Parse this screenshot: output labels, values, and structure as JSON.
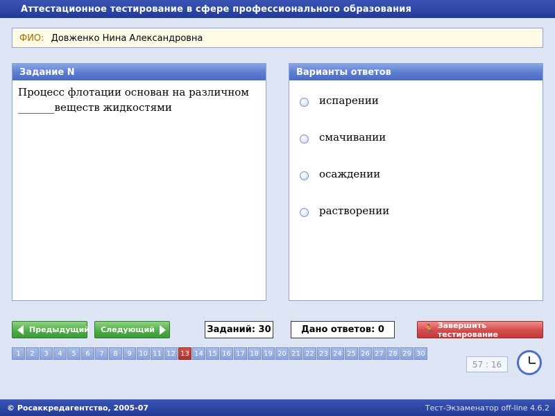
{
  "title": "Аттестационное тестирование в сфере профессионального образования",
  "fio": {
    "label": "ФИО:",
    "value": "Довженко Нина Александровна"
  },
  "question_panel": {
    "header": "Задание N",
    "line1": "Процесс флотации основан на различном",
    "line2": "_______веществ жидкостями"
  },
  "answers_panel": {
    "header": "Варианты ответов",
    "options": [
      "испарении",
      "смачивании",
      "осаждении",
      "растворении"
    ]
  },
  "nav": {
    "prev_label": "Предыдущий",
    "next_label": "Следующий",
    "tasks_counter": "Заданий: 30",
    "answers_counter": "Дано ответов: 0",
    "finish_label": "Завершить тестирование"
  },
  "pages": {
    "items": [
      "1",
      "2",
      "3",
      "4",
      "5",
      "6",
      "7",
      "8",
      "9",
      "10",
      "11",
      "12",
      "13",
      "14",
      "15",
      "16",
      "17",
      "18",
      "19",
      "20",
      "21",
      "22",
      "23",
      "24",
      "25",
      "26",
      "27",
      "28",
      "29",
      "30"
    ],
    "current": "13"
  },
  "timer": "57 : 16",
  "footer": {
    "left": "© Росаккредагентство, 2005-07",
    "right": "Тест-Экзаменатор off-line 4.6.2"
  },
  "colors": {
    "titlebar": "#2c45a3",
    "panel_header": "#5b7cd0",
    "background": "#dde4f3",
    "nav_button": "#4fae48",
    "finish_button": "#d44c4c",
    "active_page": "#b0302b"
  },
  "icons": {
    "prev": "arrow-left-icon",
    "next": "arrow-right-icon",
    "finish": "runner-icon",
    "timer": "clock-icon"
  }
}
